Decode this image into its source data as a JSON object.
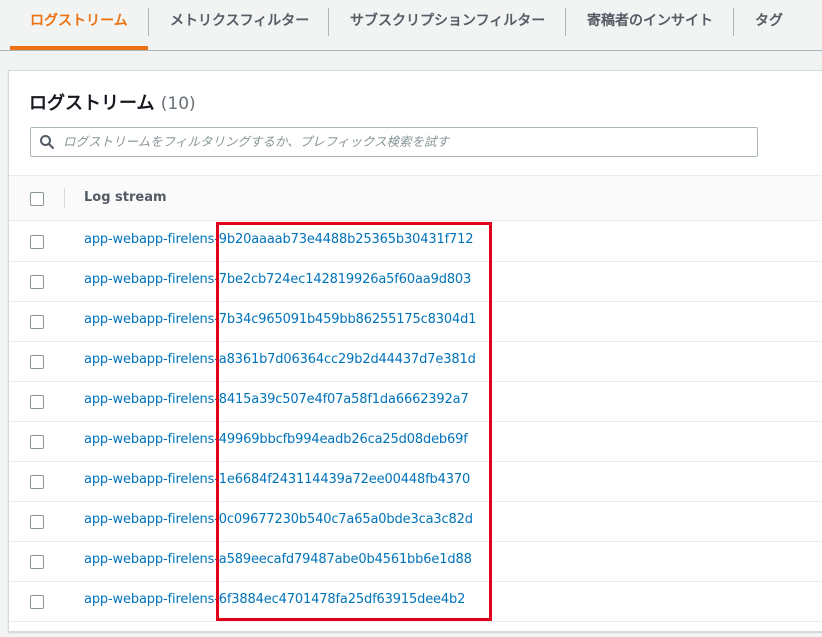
{
  "tabs": [
    {
      "label": "ログストリーム",
      "active": true
    },
    {
      "label": "メトリクスフィルター",
      "active": false
    },
    {
      "label": "サブスクリプションフィルター",
      "active": false
    },
    {
      "label": "寄稿者のインサイト",
      "active": false
    },
    {
      "label": "タグ",
      "active": false
    }
  ],
  "panel": {
    "title": "ログストリーム",
    "count": "(10)",
    "search_placeholder": "ログストリームをフィルタリングするか、プレフィックス検索を試す",
    "column_header": "Log stream"
  },
  "streams": [
    "app-webapp-firelens-9b20aaaab73e4488b25365b30431f712",
    "app-webapp-firelens-7be2cb724ec142819926a5f60aa9d803",
    "app-webapp-firelens-7b34c965091b459bb86255175c8304d1",
    "app-webapp-firelens-a8361b7d06364cc29b2d44437d7e381d",
    "app-webapp-firelens-8415a39c507e4f07a58f1da6662392a7",
    "app-webapp-firelens-49969bbcfb994eadb26ca25d08deb69f",
    "app-webapp-firelens-1e6684f243114439a72ee00448fb4370",
    "app-webapp-firelens-0c09677230b540c7a65a0bde3ca3c82d",
    "app-webapp-firelens-a589eecafd79487abe0b4561bb6e1d88",
    "app-webapp-firelens-6f3884ec4701478fa25df63915dee4b2"
  ],
  "colors": {
    "accent": "#ec7211",
    "link": "#0073bb",
    "highlight": "#e0001b"
  }
}
